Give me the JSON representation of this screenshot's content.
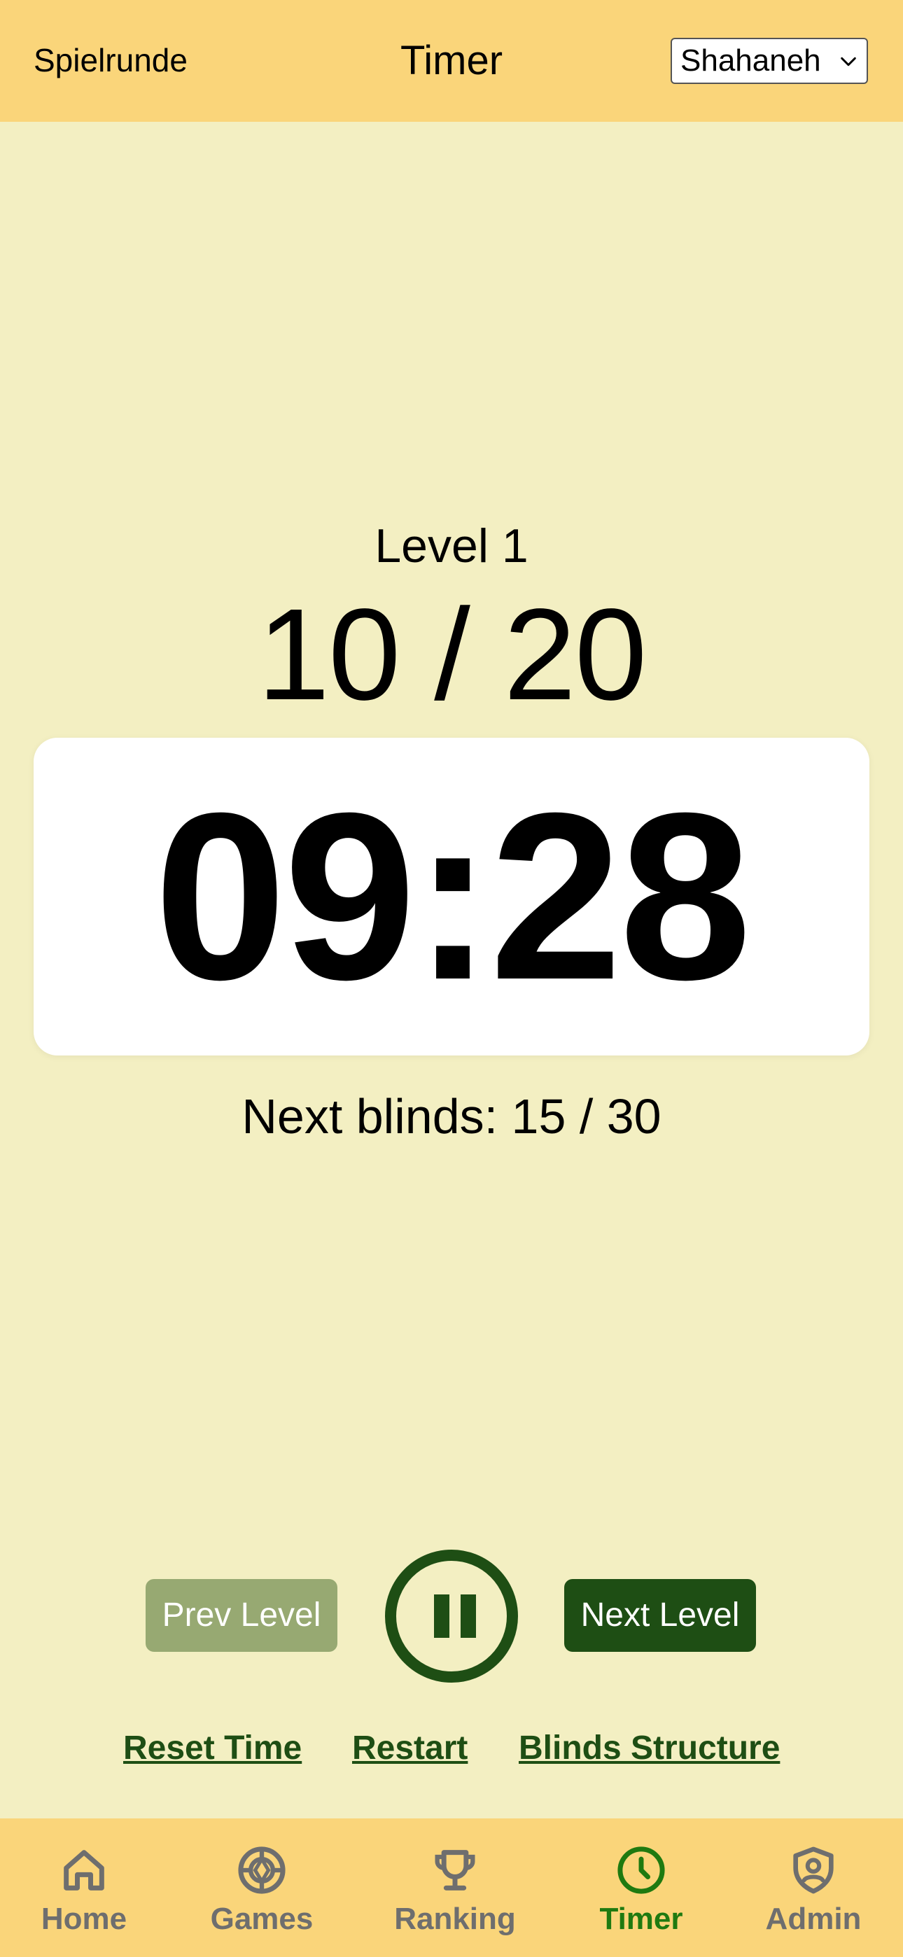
{
  "header": {
    "group_name": "Spielrunde",
    "title": "Timer",
    "user_select": {
      "selected": "Shahaneh"
    }
  },
  "level": {
    "label": "Level 1",
    "blinds": "10 / 20"
  },
  "timer": {
    "time": "09:28"
  },
  "next_blinds": "Next blinds: 15 / 30",
  "controls": {
    "prev_label": "Prev Level",
    "next_label": "Next Level",
    "pause_icon": "pause-icon"
  },
  "links": {
    "reset": "Reset Time",
    "restart": "Restart",
    "blinds_structure": "Blinds Structure"
  },
  "nav": {
    "items": [
      {
        "label": "Home",
        "icon": "home-icon",
        "active": false
      },
      {
        "label": "Games",
        "icon": "poker-chip-icon",
        "active": false
      },
      {
        "label": "Ranking",
        "icon": "trophy-icon",
        "active": false
      },
      {
        "label": "Timer",
        "icon": "clock-icon",
        "active": true
      },
      {
        "label": "Admin",
        "icon": "shield-user-icon",
        "active": false
      }
    ]
  },
  "colors": {
    "background": "#F3EFC2",
    "header": "#FAD57A",
    "accent_dark_green": "#1E4E14",
    "prev_button": "#97A972",
    "active_nav": "#1F7A10",
    "inactive_nav": "#6E6E6E"
  }
}
